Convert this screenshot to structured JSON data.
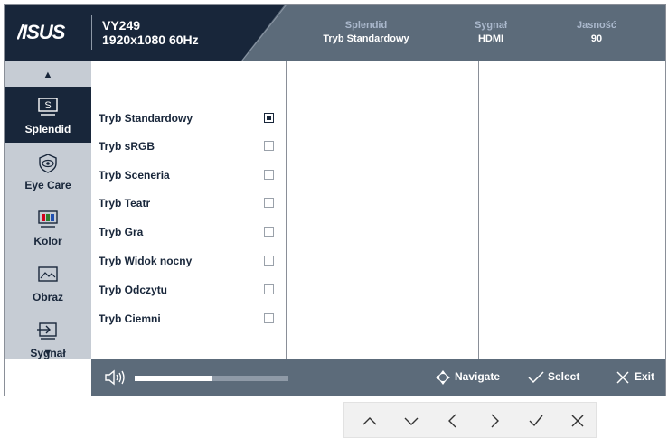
{
  "header": {
    "model": "VY249",
    "resolution": "1920x1080 60Hz",
    "info": [
      {
        "key": "Splendid",
        "value": "Tryb Standardowy"
      },
      {
        "key": "Sygnał",
        "value": "HDMI"
      },
      {
        "key": "Jasność",
        "value": "90"
      }
    ]
  },
  "sidebar": {
    "items": [
      {
        "label": "Splendid",
        "icon": "splendid-icon",
        "active": true
      },
      {
        "label": "Eye Care",
        "icon": "eye-care-icon",
        "active": false
      },
      {
        "label": "Kolor",
        "icon": "color-bars-icon",
        "active": false
      },
      {
        "label": "Obraz",
        "icon": "image-icon",
        "active": false
      },
      {
        "label": "Sygnał",
        "icon": "input-icon",
        "active": false
      }
    ]
  },
  "options": [
    {
      "label": "Tryb Standardowy",
      "checked": true
    },
    {
      "label": "Tryb sRGB",
      "checked": false
    },
    {
      "label": "Tryb Sceneria",
      "checked": false
    },
    {
      "label": "Tryb Teatr",
      "checked": false
    },
    {
      "label": "Tryb Gra",
      "checked": false
    },
    {
      "label": "Tryb Widok nocny",
      "checked": false
    },
    {
      "label": "Tryb Odczytu",
      "checked": false
    },
    {
      "label": "Tryb Ciemni",
      "checked": false
    }
  ],
  "footer": {
    "volume_fraction": 0.5,
    "navigate_label": "Navigate",
    "select_label": "Select",
    "exit_label": "Exit"
  },
  "colors": {
    "header_dark": "#18263a",
    "header_mid": "#5c6b7a",
    "sidebar_bg": "#c6ccd4"
  }
}
